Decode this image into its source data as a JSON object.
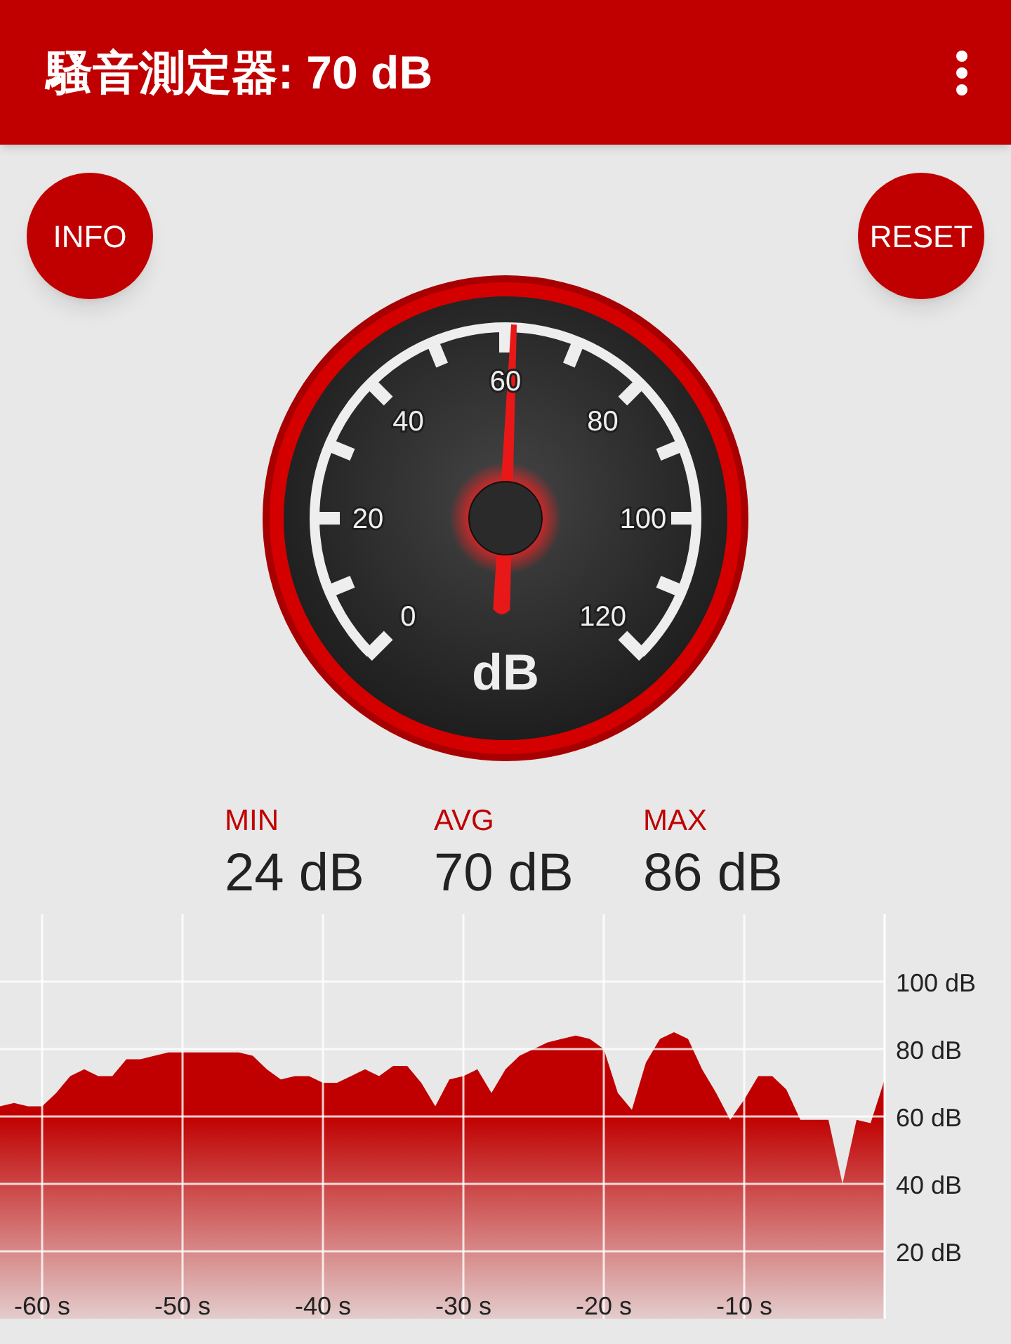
{
  "app_bar": {
    "title": "騷音測定器: 70 dB"
  },
  "buttons": [
    {
      "label": "INFO"
    },
    {
      "label": "RESET"
    }
  ],
  "gauge": {
    "scale_labels": [
      "0",
      "20",
      "40",
      "60",
      "80",
      "100",
      "120"
    ],
    "unit": "dB"
  },
  "stats": [
    {
      "label": "MIN",
      "value": "24 dB"
    },
    {
      "label": "AVG",
      "value": "70 dB"
    },
    {
      "label": "MAX",
      "value": "86 dB"
    }
  ],
  "history": {
    "chart_data": {
      "type": "area",
      "x": [
        -63,
        -62,
        -61,
        -60,
        -59,
        -58,
        -57,
        -56,
        -55,
        -54,
        -53,
        -52,
        -51,
        -50,
        -49,
        -48,
        -47,
        -46,
        -45,
        -44,
        -43,
        -42,
        -41,
        -40,
        -39,
        -38,
        -37,
        -36,
        -35,
        -34,
        -33,
        -32,
        -31,
        -30,
        -29,
        -28,
        -27,
        -26,
        -25,
        -24,
        -23,
        -22,
        -21,
        -20,
        -19,
        -18,
        -17,
        -16,
        -15,
        -14,
        -13,
        -12,
        -11,
        -10,
        -9,
        -8,
        -7,
        -6,
        -5,
        -4,
        -3,
        -2,
        -1,
        0
      ],
      "grid": true,
      "series": [
        {
          "color": "#c00000",
          "values": [
            63,
            64,
            63,
            63,
            67,
            72,
            74,
            72,
            72,
            77,
            77,
            78,
            79,
            79,
            79,
            79,
            79,
            79,
            78,
            74,
            71,
            72,
            72,
            70,
            70,
            72,
            74,
            72,
            75,
            75,
            70,
            63,
            71,
            72,
            74,
            67,
            74,
            78,
            80,
            82,
            83,
            84,
            83,
            80,
            67,
            62,
            76,
            83,
            85,
            83,
            74,
            67,
            59,
            65,
            72,
            72,
            68,
            59,
            59,
            59,
            40,
            59,
            58,
            71
          ]
        }
      ],
      "xlim": [
        -63,
        0
      ],
      "ylim": [
        0,
        120
      ],
      "xticks": [
        {
          "value": -60,
          "label": "-60 s"
        },
        {
          "value": -50,
          "label": "-50 s"
        },
        {
          "value": -40,
          "label": "-40 s"
        },
        {
          "value": -30,
          "label": "-30 s"
        },
        {
          "value": -20,
          "label": "-20 s"
        },
        {
          "value": -10,
          "label": "-10 s"
        }
      ],
      "yticks": [
        {
          "value": 20,
          "label": "20 dB"
        },
        {
          "value": 40,
          "label": "40 dB"
        },
        {
          "value": 60,
          "label": "60 dB"
        },
        {
          "value": 80,
          "label": "80 dB"
        },
        {
          "value": 100,
          "label": "100 dB"
        }
      ]
    }
  }
}
